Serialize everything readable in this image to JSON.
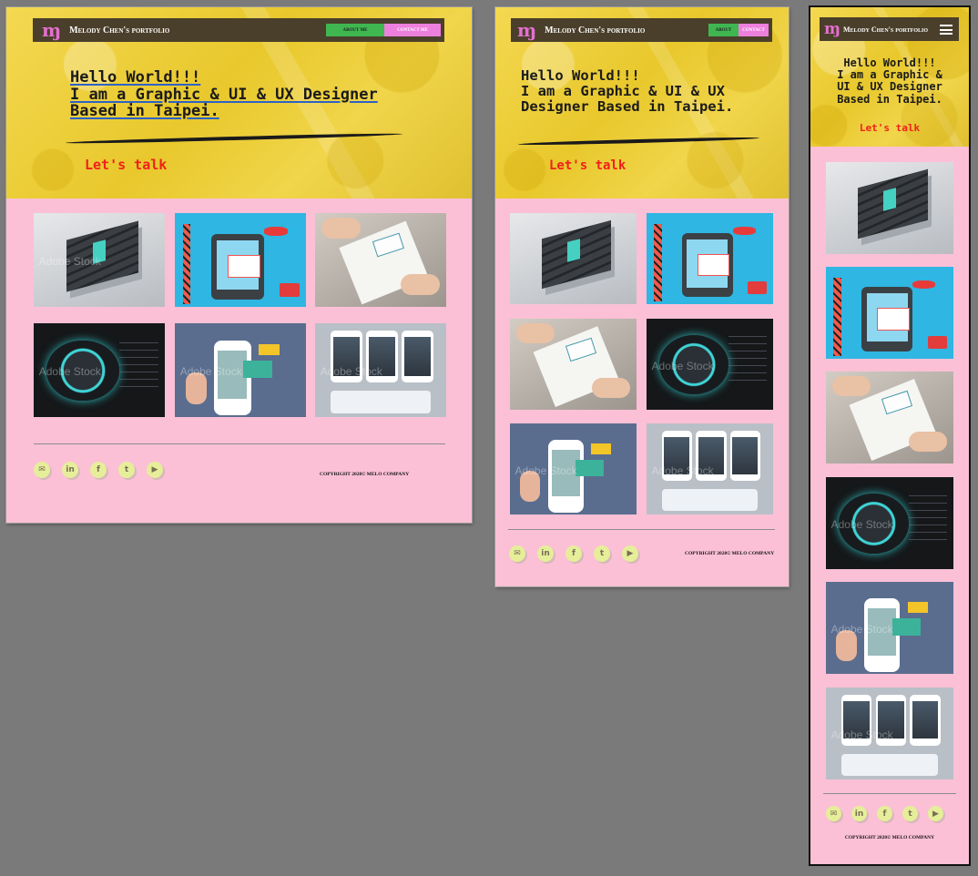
{
  "site": {
    "logo": "ɱ",
    "brand": "Melody Chen's portfolio",
    "nav": {
      "about_wide": "ABOUT ME",
      "about_short": "ABOUT",
      "contact_wide": "CONTACT ME",
      "contact_short": "CONTACT"
    },
    "menu_icon": "hamburger-menu-icon"
  },
  "hero": {
    "line1": "Hello World!!!",
    "line2_wide": "I am a Graphic & UI & UX Designer",
    "line3_wide": "Based in Taipei.",
    "line2_mid": "I am a Graphic & UI & UX",
    "line3_mid": "Designer Based in Taipei.",
    "m_line2": "I am a Graphic &",
    "m_line3": "UI & UX Designer",
    "m_line4": "Based in Taipei.",
    "cta": "Let's talk"
  },
  "gallery": {
    "watermark": "Adobe Stock",
    "tiles": [
      "isometric-phone",
      "app-construction",
      "hands-sketching",
      "dial-knob",
      "mobile-shopping",
      "app-screens"
    ]
  },
  "social": [
    "mail-icon",
    "linkedin-icon",
    "facebook-icon",
    "twitter-icon",
    "youtube-icon"
  ],
  "social_glyphs": [
    "✉",
    "in",
    "f",
    "t",
    "▶"
  ],
  "footer": {
    "copyright": "COPYRIGHT 2020© MELO COMPANY"
  },
  "colors": {
    "page_bg": "#fbc0d6",
    "hero_yellow": "#f1d54a",
    "nav_bg": "#4a3f2a",
    "about_green": "#3fb650",
    "contact_pink": "#ee80dd",
    "cta_red": "#f0201c",
    "canvas": "#7a7a7a"
  }
}
